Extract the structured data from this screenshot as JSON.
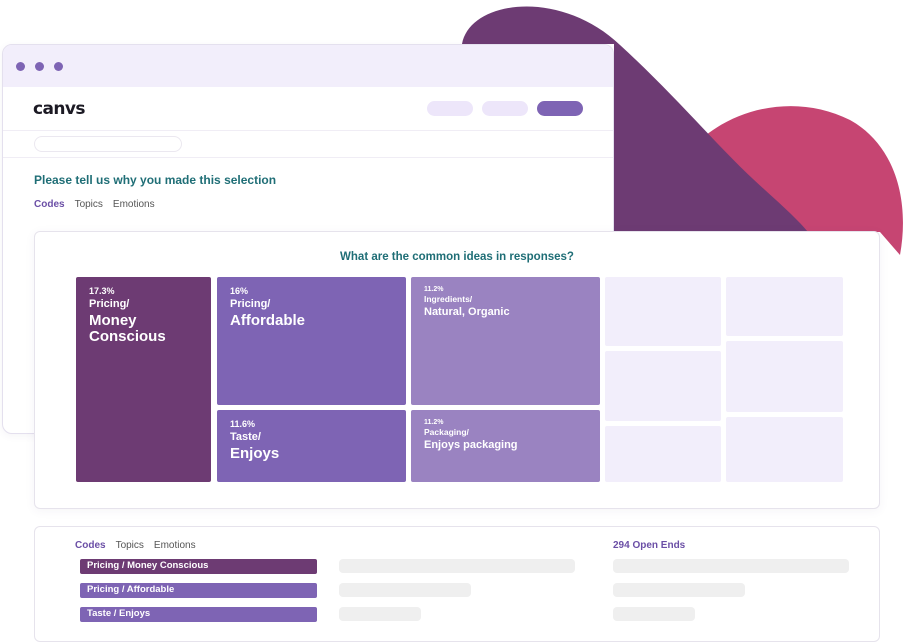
{
  "app": {
    "logo": "canvs"
  },
  "colors": {
    "plum": "#6d3b73",
    "purple": "#7e64b4",
    "lavender": "#9a83c1",
    "pale": "#f2eefb",
    "teal": "#1f6e76",
    "pink_blob": "#c64572"
  },
  "window": {
    "question": "Please tell us why you made this selection",
    "tabs": [
      "Codes",
      "Topics",
      "Emotions"
    ]
  },
  "treemap": {
    "title": "What are the common ideas in responses?",
    "tiles": [
      {
        "percent": "17.3%",
        "category": "Pricing/",
        "name": "Money Conscious"
      },
      {
        "percent": "16%",
        "category": "Pricing/",
        "name": "Affordable"
      },
      {
        "percent": "11.6%",
        "category": "Taste/",
        "name": "Enjoys"
      },
      {
        "percent": "11.2%",
        "category": "Ingredients/",
        "name": "Natural, Organic"
      },
      {
        "percent": "11.2%",
        "category": "Packaging/",
        "name": "Enjoys packaging"
      }
    ]
  },
  "bottom": {
    "tabs": [
      "Codes",
      "Topics",
      "Emotions"
    ],
    "open_ends": "294 Open Ends",
    "codes": [
      "Pricing / Money Conscious",
      "Pricing / Affordable",
      "Taste / Enjoys"
    ]
  }
}
